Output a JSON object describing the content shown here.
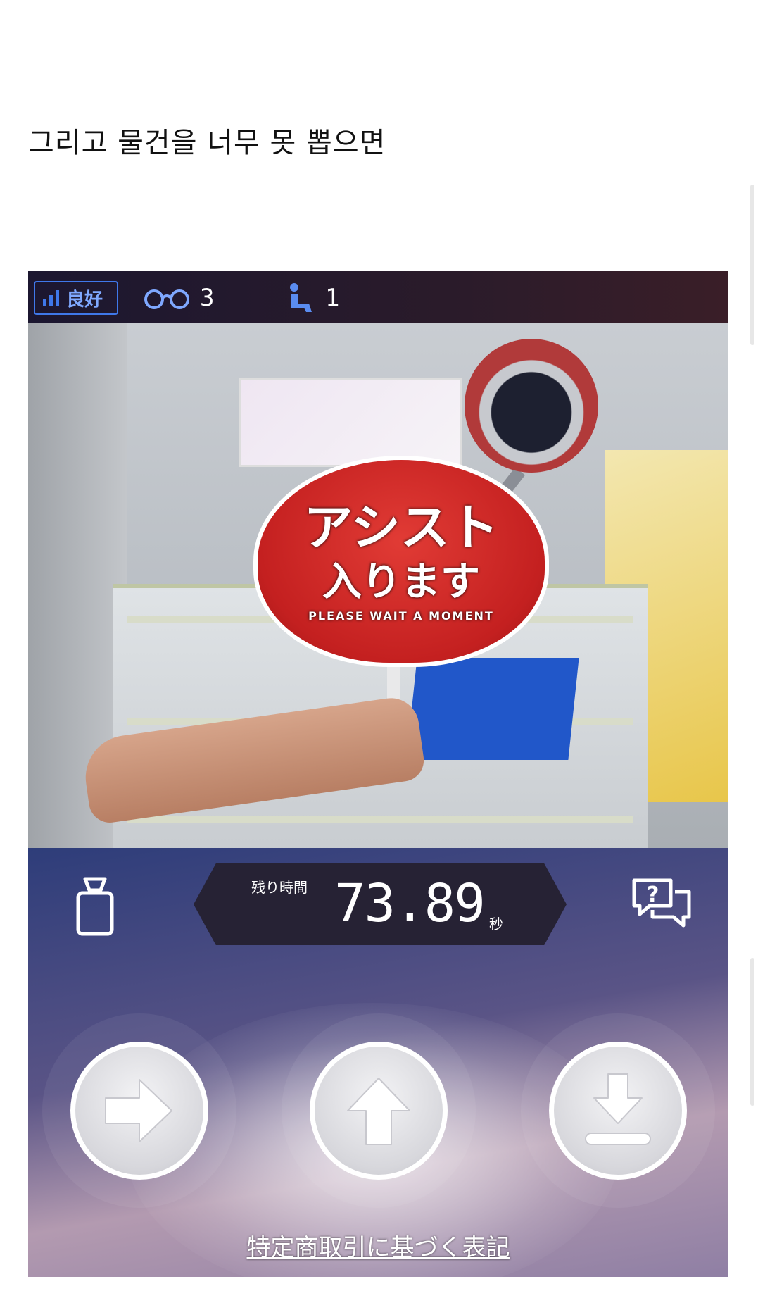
{
  "post": {
    "caption": "그리고 물건을 너무 못 뽑으면"
  },
  "game": {
    "status": {
      "connection_label": "良好",
      "viewer_count": "3",
      "player_count": "1"
    },
    "camera": {
      "fan_text_line1": "アシスト",
      "fan_text_line2": "入ります",
      "fan_text_line3": "PLEASE WAIT A MOMENT"
    },
    "timer": {
      "label": "残り時間",
      "value": "73.89",
      "unit": "秒"
    },
    "controls": {
      "right_icon": "arrow-right-icon",
      "up_icon": "arrow-up-icon",
      "drop_icon": "drop-down-icon"
    },
    "legal_link": "特定商取引に基づく表記"
  },
  "colors": {
    "signal_blue": "#3f78ea",
    "panel_navy": "#2e3d7a",
    "fan_red": "#c42020"
  }
}
